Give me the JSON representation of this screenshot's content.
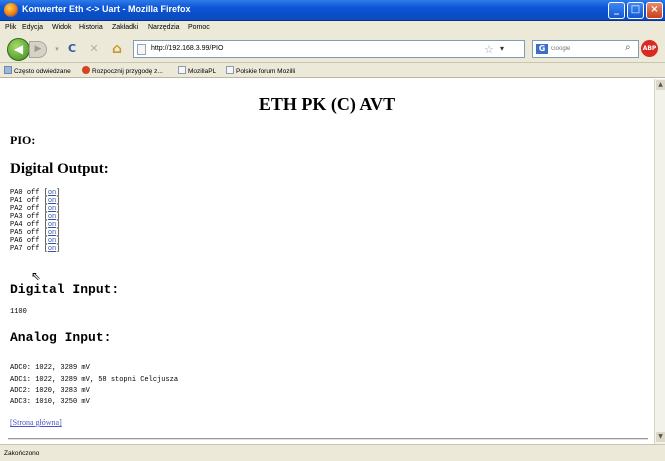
{
  "window": {
    "title": "Konwerter Eth <-> Uart - Mozilla Firefox",
    "min_label": "_",
    "max_label": "□",
    "close_label": "×"
  },
  "menu": [
    "Plik",
    "Edycja",
    "Widok",
    "Historia",
    "Zakładki",
    "Narzędzia",
    "Pomoc"
  ],
  "nav": {
    "back_glyph": "◀",
    "forward_glyph": "▶",
    "reload_glyph": "C",
    "stop_glyph": "✕",
    "home_glyph": "⌂",
    "url": "http://192.168.3.99/PIO",
    "search_placeholder": "Google",
    "search_engine_glyph": "G",
    "bookmark_star_glyph": "☆",
    "dropdown_glyph": "▾",
    "search_glyph": "⌕",
    "adblock_label": "ABP"
  },
  "bookmarks": [
    "Często odwiedzane",
    "Rozpocznij przygodę z...",
    "MozillaPL",
    "Polskie forum Mozilli"
  ],
  "page": {
    "title": "ETH PK (C) AVT",
    "pio_heading": "PIO:",
    "digital_output_heading": "Digital Output:",
    "outputs": [
      {
        "name": "PA0",
        "state": "off",
        "link": "on"
      },
      {
        "name": "PA1",
        "state": "off",
        "link": "on"
      },
      {
        "name": "PA2",
        "state": "off",
        "link": "on"
      },
      {
        "name": "PA3",
        "state": "off",
        "link": "on"
      },
      {
        "name": "PA4",
        "state": "off",
        "link": "on"
      },
      {
        "name": "PA5",
        "state": "off",
        "link": "on"
      },
      {
        "name": "PA6",
        "state": "off",
        "link": "on"
      },
      {
        "name": "PA7",
        "state": "off",
        "link": "on"
      }
    ],
    "digital_input_heading": "Digital Input:",
    "digital_input_value": "1100",
    "analog_input_heading": "Analog Input:",
    "adc_lines": [
      "ADC0: 1022, 3289 mV",
      "ADC1: 1022, 3289 mV, 58 stopni Celcjusza",
      "ADC2: 1020, 3283 mV",
      "ADC3: 1010, 3250 mV"
    ],
    "home_link": "[Strona główna]"
  },
  "status": "Zakończono",
  "colors": {
    "link": "#3452a8",
    "titlebar": "#0b55d6",
    "chrome": "#ece9d8"
  }
}
